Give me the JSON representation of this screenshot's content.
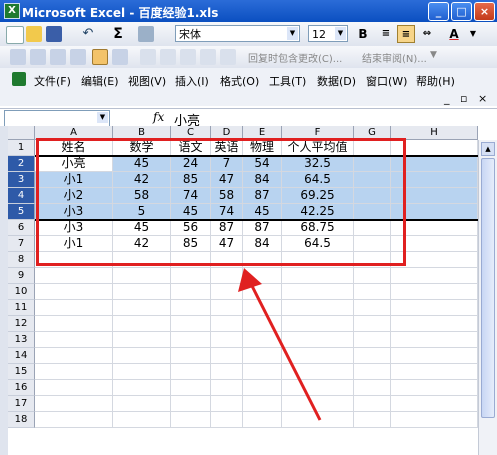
{
  "window": {
    "title": "Microsoft Excel - 百度经验1.xls",
    "app_icon": "X"
  },
  "toolbar": {
    "font_name": "宋体",
    "font_size": "12",
    "bold_label": "B",
    "font_color_label": "A",
    "reply_label": "回复时包含更改(C)...",
    "end_review_label": "结束审阅(N)..."
  },
  "menu": {
    "items": [
      {
        "label": "文件(F)"
      },
      {
        "label": "编辑(E)"
      },
      {
        "label": "视图(V)"
      },
      {
        "label": "插入(I)"
      },
      {
        "label": "格式(O)"
      },
      {
        "label": "工具(T)"
      },
      {
        "label": "数据(D)"
      },
      {
        "label": "窗口(W)"
      },
      {
        "label": "帮助(H)"
      }
    ]
  },
  "formula": {
    "fx": "fx",
    "value": "小亮",
    "namebox": ""
  },
  "columns": [
    "A",
    "B",
    "C",
    "D",
    "E",
    "F",
    "G",
    "H"
  ],
  "rows": [
    "1",
    "2",
    "3",
    "4",
    "5",
    "6",
    "7",
    "8",
    "9",
    "10",
    "11",
    "12",
    "13",
    "14",
    "15",
    "16",
    "17",
    "18"
  ],
  "table": {
    "headers": [
      "姓名",
      "数学",
      "语文",
      "英语",
      "物理",
      "个人平均值"
    ],
    "data": [
      [
        "小亮",
        "45",
        "24",
        "7",
        "54",
        "32.5"
      ],
      [
        "小1",
        "42",
        "85",
        "47",
        "84",
        "64.5"
      ],
      [
        "小2",
        "58",
        "74",
        "58",
        "87",
        "69.25"
      ],
      [
        "小3",
        "5",
        "45",
        "74",
        "45",
        "42.25"
      ],
      [
        "小3",
        "45",
        "56",
        "87",
        "87",
        "68.75"
      ],
      [
        "小1",
        "42",
        "85",
        "47",
        "84",
        "64.5"
      ]
    ]
  },
  "colors": {
    "highlight_red": "#e02020",
    "selection": "#b8d3f0",
    "title_blue": "#0b4fc0"
  }
}
